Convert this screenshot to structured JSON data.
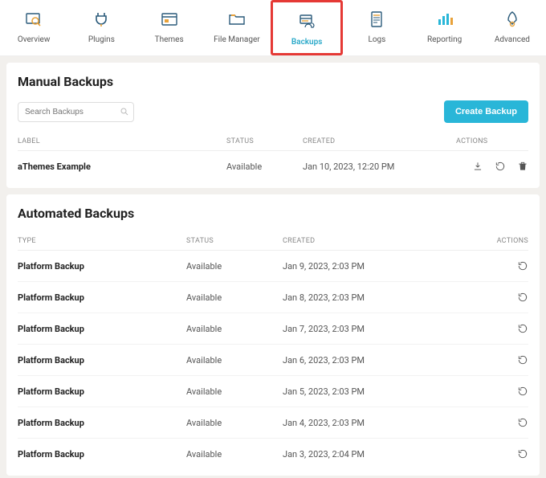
{
  "tabs": [
    {
      "label": "Overview"
    },
    {
      "label": "Plugins"
    },
    {
      "label": "Themes"
    },
    {
      "label": "File Manager"
    },
    {
      "label": "Backups"
    },
    {
      "label": "Logs"
    },
    {
      "label": "Reporting"
    },
    {
      "label": "Advanced"
    }
  ],
  "manual": {
    "title": "Manual Backups",
    "search_placeholder": "Search Backups",
    "create_label": "Create Backup",
    "head": {
      "label": "LABEL",
      "status": "STATUS",
      "created": "CREATED",
      "actions": "ACTIONS"
    },
    "rows": [
      {
        "label": "aThemes Example",
        "status": "Available",
        "created": "Jan 10, 2023, 12:20 PM"
      }
    ]
  },
  "auto": {
    "title": "Automated Backups",
    "head": {
      "type": "TYPE",
      "status": "STATUS",
      "created": "CREATED",
      "actions": "ACTIONS"
    },
    "rows": [
      {
        "type": "Platform Backup",
        "status": "Available",
        "created": "Jan 9, 2023, 2:03 PM"
      },
      {
        "type": "Platform Backup",
        "status": "Available",
        "created": "Jan 8, 2023, 2:03 PM"
      },
      {
        "type": "Platform Backup",
        "status": "Available",
        "created": "Jan 7, 2023, 2:03 PM"
      },
      {
        "type": "Platform Backup",
        "status": "Available",
        "created": "Jan 6, 2023, 2:03 PM"
      },
      {
        "type": "Platform Backup",
        "status": "Available",
        "created": "Jan 5, 2023, 2:03 PM"
      },
      {
        "type": "Platform Backup",
        "status": "Available",
        "created": "Jan 4, 2023, 2:03 PM"
      },
      {
        "type": "Platform Backup",
        "status": "Available",
        "created": "Jan 3, 2023, 2:04 PM"
      }
    ]
  }
}
